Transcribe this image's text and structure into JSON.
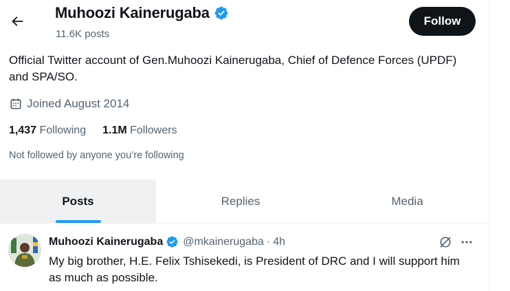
{
  "header": {
    "name": "Muhoozi Kainerugaba",
    "posts_count": "11.6K posts",
    "follow_label": "Follow",
    "back_icon": "arrow-left-icon",
    "verified_icon": "verified-badge-icon"
  },
  "profile": {
    "bio": "Official Twitter account of Gen.Muhoozi Kainerugaba, Chief of Defence Forces (UPDF) and SPA/SO.",
    "joined": "Joined August 2014",
    "joined_icon": "calendar-icon",
    "following_count": "1,437",
    "following_label": "Following",
    "followers_count": "1.1M",
    "followers_label": "Followers",
    "not_followed": "Not followed by anyone you’re following"
  },
  "tabs": [
    {
      "label": "Posts",
      "active": true
    },
    {
      "label": "Replies",
      "active": false
    },
    {
      "label": "Media",
      "active": false
    }
  ],
  "tweet": {
    "name": "Muhoozi Kainerugaba",
    "handle": "@mkainerugaba",
    "separator": "·",
    "time": "4h",
    "text": "My big brother, H.E. Felix Tshisekedi, is President of DRC and I will support him as much as possible.",
    "grok_icon": "grok-icon",
    "more_icon": "more-options-icon"
  },
  "colors": {
    "accent": "#1d9bf0",
    "text_primary": "#0f1419",
    "text_secondary": "#536471",
    "button_dark": "#0f1419",
    "active_tab_bg": "#eff1f2"
  }
}
